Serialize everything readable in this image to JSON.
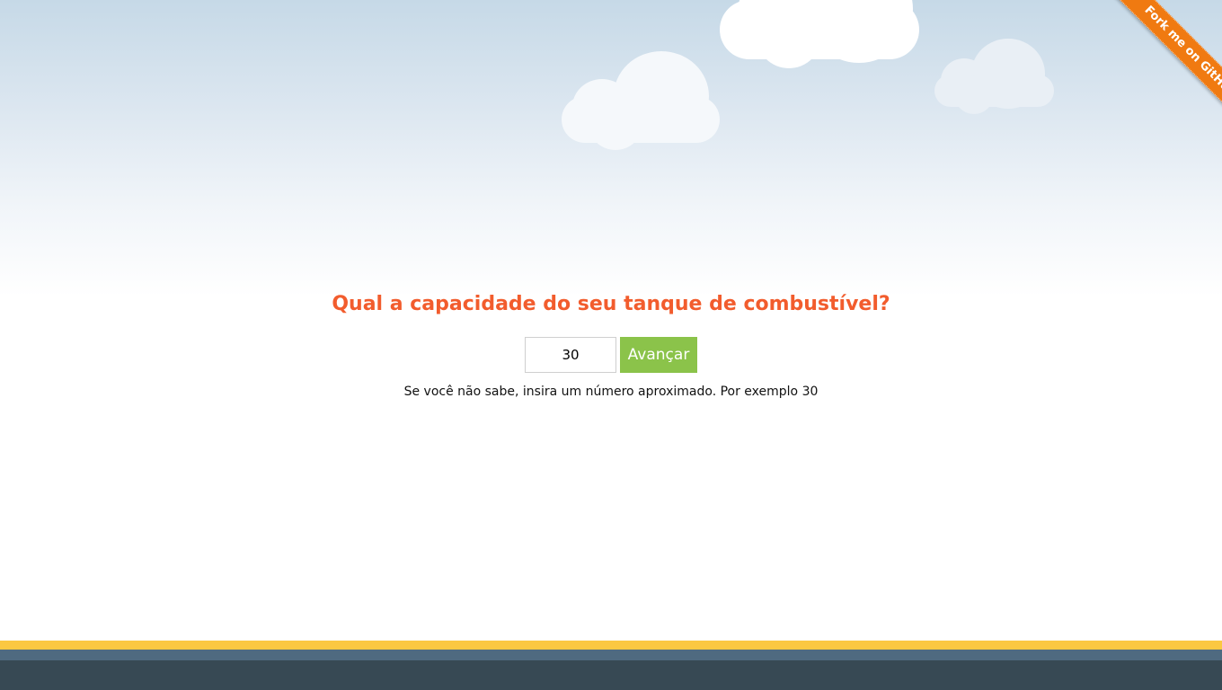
{
  "ribbon": {
    "label": "Fork me on GitHub",
    "color": "#f07a11"
  },
  "main": {
    "question": "Qual a capacidade do seu tanque de combustível?",
    "tank_input_value": "30",
    "next_button_label": "Avançar",
    "hint": "Se você não sabe, insira um número aproximado. Por exemplo 30"
  },
  "colors": {
    "question": "#f25c2d",
    "button": "#8bc34a",
    "footer_yellow": "#fbc842",
    "footer_blue": "#4f6a80",
    "footer_dark": "#374954"
  }
}
